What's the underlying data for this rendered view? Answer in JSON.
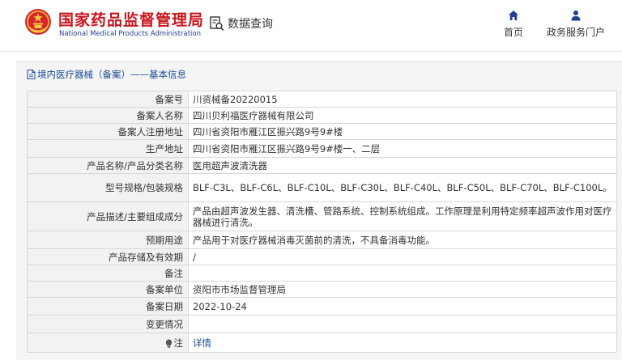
{
  "header": {
    "brand_cn": "国家药品监督管理局",
    "brand_en": "National Medical Products Administration",
    "data_query": "数据查询",
    "nav_home": "首页",
    "nav_gov": "政务服务门户"
  },
  "section": {
    "title": "境内医疗器械（备案）——基本信息"
  },
  "rows": [
    {
      "label": "备案号",
      "value": "川资械备20220015"
    },
    {
      "label": "备案人名称",
      "value": "四川贝利福医疗器械有限公司"
    },
    {
      "label": "备案人注册地址",
      "value": "四川省资阳市雁江区振兴路9号9#楼"
    },
    {
      "label": "生产地址",
      "value": "四川省资阳市雁江区振兴路9号9#楼一、二层"
    },
    {
      "label": "产品名称/产品分类名称",
      "value": "医用超声波清洗器"
    },
    {
      "label": "型号规格/包装规格",
      "value": "BLF-C3L、BLF-C6L、BLF-C10L、BLF-C30L、BLF-C40L、BLF-C50L、BLF-C70L、BLF-C100L。"
    },
    {
      "label": "产品描述/主要组成成分",
      "value": "产品由超声波发生器、清洗槽、管路系统、控制系统组成。工作原理是利用特定频率超声波作用对医疗器械进行清洗。"
    },
    {
      "label": "预期用途",
      "value": "产品用于对医疗器械消毒灭菌前的清洗，不具备消毒功能。"
    },
    {
      "label": "产品存储及有效期",
      "value": "/"
    },
    {
      "label": "备注",
      "value": ""
    },
    {
      "label": "备案单位",
      "value": "资阳市市场监督管理局"
    },
    {
      "label": "备案日期",
      "value": "2022-10-24"
    },
    {
      "label": "变更情况",
      "value": ""
    }
  ],
  "note_row": {
    "label": "注",
    "link": "详情"
  },
  "colors": {
    "brand_red": "#c8161d",
    "link_blue": "#1a4a94",
    "nav_icon_blue": "#1f3f8f"
  },
  "icons": {
    "emblem": "national-emblem-icon",
    "data_query": "document-search-icon",
    "home": "home-icon",
    "user": "user-icon",
    "section": "document-icon",
    "note": "lightbulb-icon"
  }
}
